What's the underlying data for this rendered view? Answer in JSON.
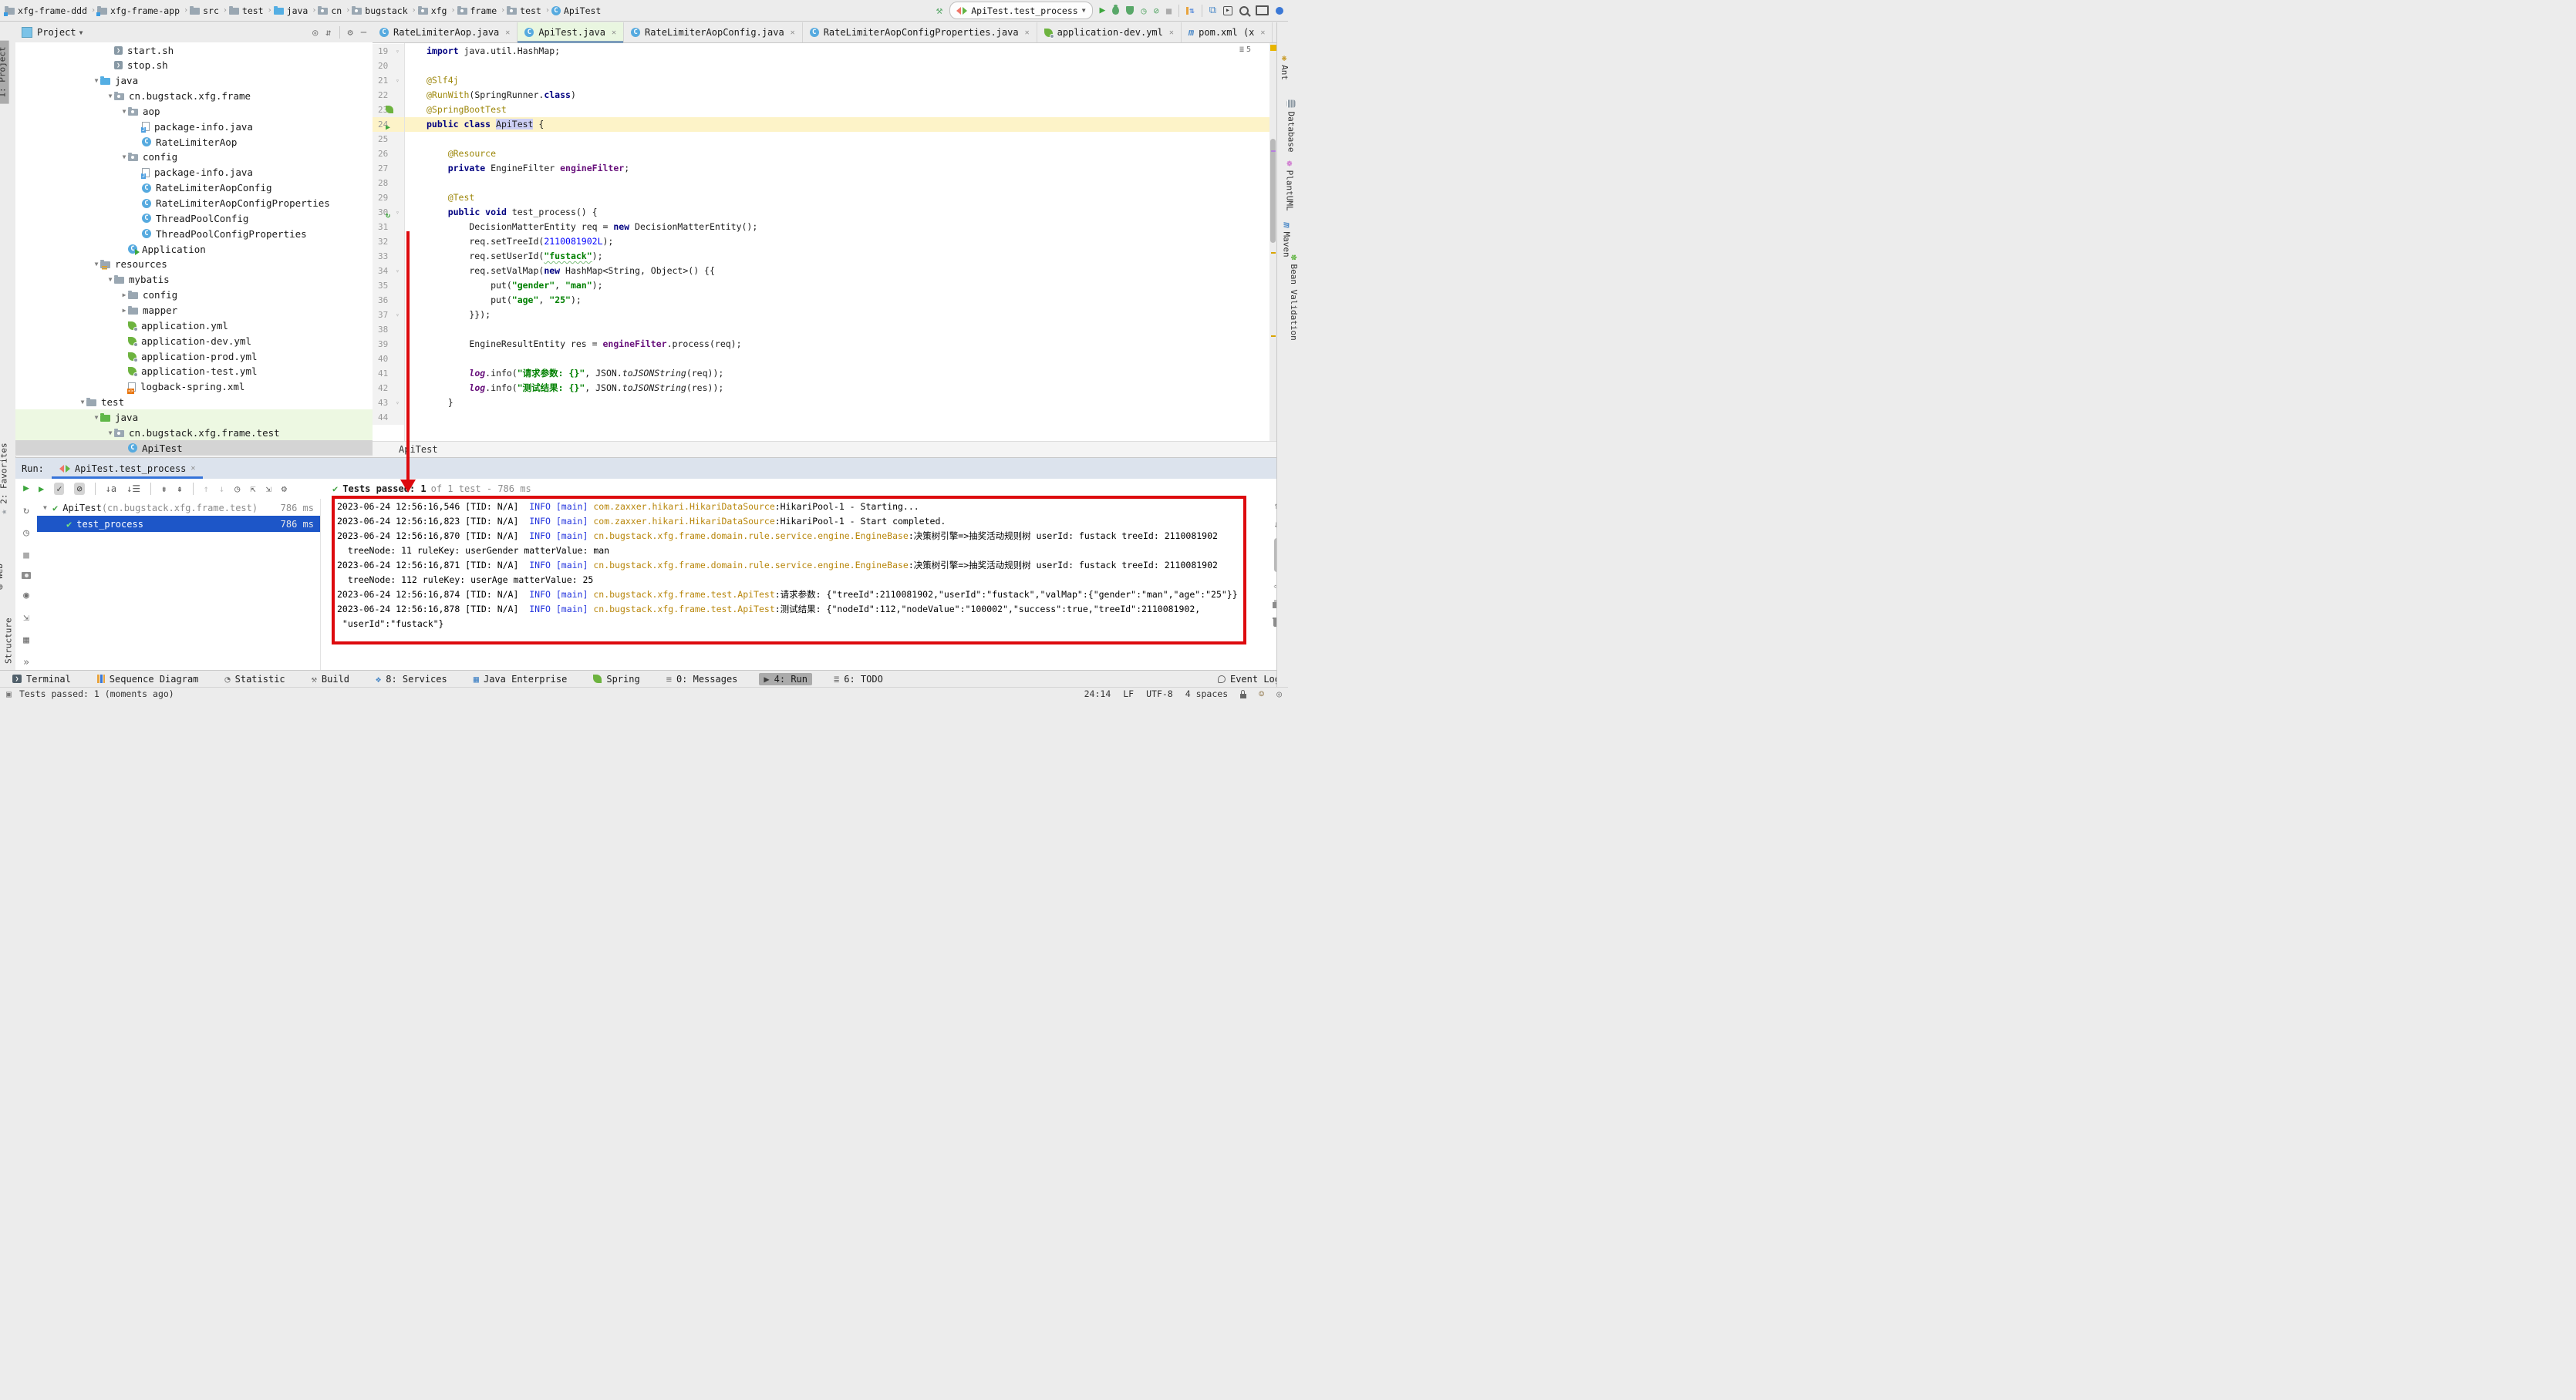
{
  "titlebar": {
    "breadcrumbs": [
      {
        "icon": "module-folder",
        "label": "xfg-frame-ddd"
      },
      {
        "icon": "module-folder",
        "label": "xfg-frame-app"
      },
      {
        "icon": "folder",
        "label": "src"
      },
      {
        "icon": "folder",
        "label": "test"
      },
      {
        "icon": "java-folder",
        "label": "java"
      },
      {
        "icon": "package",
        "label": "cn"
      },
      {
        "icon": "package",
        "label": "bugstack"
      },
      {
        "icon": "package",
        "label": "xfg"
      },
      {
        "icon": "package",
        "label": "frame"
      },
      {
        "icon": "package",
        "label": "test"
      },
      {
        "icon": "class",
        "label": "ApiTest"
      }
    ],
    "run_config_label": "ApiTest.test_process",
    "actions": [
      "build-hammer",
      "run",
      "debug",
      "coverage",
      "profiler",
      "profiler-attach",
      "stop",
      "sep",
      "update-sync",
      "sep",
      "project-structure",
      "run-anything",
      "search-everywhere",
      "monitor",
      "presence"
    ]
  },
  "tabs": [
    {
      "icon": "class",
      "label": "RateLimiterAop.java",
      "active": false
    },
    {
      "icon": "junit-class",
      "label": "ApiTest.java",
      "active": true
    },
    {
      "icon": "class",
      "label": "RateLimiterAopConfig.java",
      "active": false
    },
    {
      "icon": "class",
      "label": "RateLimiterAopConfigProperties.java",
      "active": false
    },
    {
      "icon": "spring-yml",
      "label": "application-dev.yml",
      "active": false
    },
    {
      "icon": "maven",
      "label": "pom.xml (x",
      "active": false
    }
  ],
  "tab_overflow": {
    "icon": "tab-list",
    "count": "5"
  },
  "project": {
    "title": "Project",
    "header_icons": [
      "locate",
      "collapse-all",
      "sep",
      "settings",
      "hide"
    ],
    "tree": [
      {
        "depth": 5,
        "arrow": "",
        "icon": "sh",
        "label": "start.sh",
        "bg": ""
      },
      {
        "depth": 5,
        "arrow": "",
        "icon": "sh",
        "label": "stop.sh",
        "bg": ""
      },
      {
        "depth": 4,
        "arrow": "down",
        "icon": "java-folder",
        "label": "java",
        "bg": ""
      },
      {
        "depth": 5,
        "arrow": "down",
        "icon": "package",
        "label": "cn.bugstack.xfg.frame",
        "bg": ""
      },
      {
        "depth": 6,
        "arrow": "down",
        "icon": "package",
        "label": "aop",
        "bg": ""
      },
      {
        "depth": 7,
        "arrow": "",
        "icon": "pkginfo",
        "label": "package-info.java",
        "bg": ""
      },
      {
        "depth": 7,
        "arrow": "",
        "icon": "class",
        "label": "RateLimiterAop",
        "bg": ""
      },
      {
        "depth": 6,
        "arrow": "down",
        "icon": "package",
        "label": "config",
        "bg": ""
      },
      {
        "depth": 7,
        "arrow": "",
        "icon": "pkginfo",
        "label": "package-info.java",
        "bg": ""
      },
      {
        "depth": 7,
        "arrow": "",
        "icon": "class",
        "label": "RateLimiterAopConfig",
        "bg": ""
      },
      {
        "depth": 7,
        "arrow": "",
        "icon": "class",
        "label": "RateLimiterAopConfigProperties",
        "bg": ""
      },
      {
        "depth": 7,
        "arrow": "",
        "icon": "class",
        "label": "ThreadPoolConfig",
        "bg": ""
      },
      {
        "depth": 7,
        "arrow": "",
        "icon": "class",
        "label": "ThreadPoolConfigProperties",
        "bg": ""
      },
      {
        "depth": 6,
        "arrow": "",
        "icon": "class-run",
        "label": "Application",
        "bg": ""
      },
      {
        "depth": 4,
        "arrow": "down",
        "icon": "resources-folder",
        "label": "resources",
        "bg": ""
      },
      {
        "depth": 5,
        "arrow": "down",
        "icon": "folder",
        "label": "mybatis",
        "bg": ""
      },
      {
        "depth": 6,
        "arrow": "right",
        "icon": "folder",
        "label": "config",
        "bg": ""
      },
      {
        "depth": 6,
        "arrow": "right",
        "icon": "folder",
        "label": "mapper",
        "bg": ""
      },
      {
        "depth": 6,
        "arrow": "",
        "icon": "spring-yml",
        "label": "application.yml",
        "bg": ""
      },
      {
        "depth": 6,
        "arrow": "",
        "icon": "spring-yml",
        "label": "application-dev.yml",
        "bg": ""
      },
      {
        "depth": 6,
        "arrow": "",
        "icon": "spring-yml",
        "label": "application-prod.yml",
        "bg": ""
      },
      {
        "depth": 6,
        "arrow": "",
        "icon": "spring-yml",
        "label": "application-test.yml",
        "bg": ""
      },
      {
        "depth": 6,
        "arrow": "",
        "icon": "xml",
        "label": "logback-spring.xml",
        "bg": ""
      },
      {
        "depth": 3,
        "arrow": "down",
        "icon": "folder",
        "label": "test",
        "bg": ""
      },
      {
        "depth": 4,
        "arrow": "down",
        "icon": "test-folder",
        "label": "java",
        "bg": "green"
      },
      {
        "depth": 5,
        "arrow": "down",
        "icon": "package",
        "label": "cn.bugstack.xfg.frame.test",
        "bg": "green"
      },
      {
        "depth": 6,
        "arrow": "",
        "icon": "class",
        "label": "ApiTest",
        "bg": "sel"
      }
    ]
  },
  "editor": {
    "breadcrumb": "ApiTest",
    "inspections_count": "5",
    "lines": [
      {
        "no": "19",
        "gutter": "",
        "fold": "v",
        "caret": false,
        "segs": [
          [
            "k",
            "import"
          ],
          [
            "p",
            " java.util.HashMap;"
          ]
        ]
      },
      {
        "no": "20",
        "gutter": "",
        "fold": "",
        "caret": false,
        "segs": []
      },
      {
        "no": "21",
        "gutter": "",
        "fold": "v",
        "caret": false,
        "segs": [
          [
            "ann",
            "@Slf4j"
          ]
        ]
      },
      {
        "no": "22",
        "gutter": "",
        "fold": "",
        "caret": false,
        "segs": [
          [
            "ann",
            "@RunWith"
          ],
          [
            "p",
            "(SpringRunner."
          ],
          [
            "k",
            "class"
          ],
          [
            "p",
            ")"
          ]
        ]
      },
      {
        "no": "23",
        "gutter": "leaf",
        "fold": "",
        "caret": false,
        "segs": [
          [
            "ann",
            "@SpringBootTest"
          ]
        ]
      },
      {
        "no": "24",
        "gutter": "run",
        "fold": "",
        "caret": true,
        "segs": [
          [
            "k",
            "public class "
          ],
          [
            "hlw",
            "ApiTest"
          ],
          [
            "p",
            " {"
          ]
        ]
      },
      {
        "no": "25",
        "gutter": "",
        "fold": "",
        "caret": false,
        "segs": []
      },
      {
        "no": "26",
        "gutter": "",
        "fold": "",
        "caret": false,
        "segs": [
          [
            "p",
            "    "
          ],
          [
            "ann",
            "@Resource"
          ]
        ]
      },
      {
        "no": "27",
        "gutter": "",
        "fold": "",
        "caret": false,
        "segs": [
          [
            "p",
            "    "
          ],
          [
            "k",
            "private"
          ],
          [
            "p",
            " EngineFilter "
          ],
          [
            "f",
            "engineFilter"
          ],
          [
            "p",
            ";"
          ]
        ]
      },
      {
        "no": "28",
        "gutter": "",
        "fold": "",
        "caret": false,
        "segs": []
      },
      {
        "no": "29",
        "gutter": "",
        "fold": "",
        "caret": false,
        "segs": [
          [
            "p",
            "    "
          ],
          [
            "ann",
            "@Test"
          ]
        ]
      },
      {
        "no": "30",
        "gutter": "rerun",
        "fold": "v",
        "caret": false,
        "segs": [
          [
            "p",
            "    "
          ],
          [
            "k",
            "public void"
          ],
          [
            "p",
            " test_process() {"
          ]
        ]
      },
      {
        "no": "31",
        "gutter": "",
        "fold": "",
        "caret": false,
        "segs": [
          [
            "p",
            "        DecisionMatterEntity req = "
          ],
          [
            "k",
            "new"
          ],
          [
            "p",
            " DecisionMatterEntity();"
          ]
        ]
      },
      {
        "no": "32",
        "gutter": "",
        "fold": "",
        "caret": false,
        "segs": [
          [
            "p",
            "        req.setTreeId("
          ],
          [
            "n",
            "2110081902L"
          ],
          [
            "p",
            ");"
          ]
        ]
      },
      {
        "no": "33",
        "gutter": "",
        "fold": "",
        "caret": false,
        "segs": [
          [
            "p",
            "        req.setUserId("
          ],
          [
            "styp",
            "\"fustack\""
          ],
          [
            "p",
            ");"
          ]
        ]
      },
      {
        "no": "34",
        "gutter": "",
        "fold": "v",
        "caret": false,
        "segs": [
          [
            "p",
            "        req.setValMap("
          ],
          [
            "k",
            "new"
          ],
          [
            "p",
            " HashMap<String, Object>() {{"
          ]
        ]
      },
      {
        "no": "35",
        "gutter": "",
        "fold": "",
        "caret": false,
        "segs": [
          [
            "p",
            "            put("
          ],
          [
            "s",
            "\"gender\""
          ],
          [
            "p",
            ", "
          ],
          [
            "s",
            "\"man\""
          ],
          [
            "p",
            ");"
          ]
        ]
      },
      {
        "no": "36",
        "gutter": "",
        "fold": "",
        "caret": false,
        "segs": [
          [
            "p",
            "            put("
          ],
          [
            "s",
            "\"age\""
          ],
          [
            "p",
            ", "
          ],
          [
            "s",
            "\"25\""
          ],
          [
            "p",
            ");"
          ]
        ]
      },
      {
        "no": "37",
        "gutter": "",
        "fold": "v",
        "caret": false,
        "segs": [
          [
            "p",
            "        }});"
          ]
        ]
      },
      {
        "no": "38",
        "gutter": "",
        "fold": "",
        "caret": false,
        "segs": []
      },
      {
        "no": "39",
        "gutter": "",
        "fold": "",
        "caret": false,
        "segs": [
          [
            "p",
            "        EngineResultEntity res = "
          ],
          [
            "f",
            "engineFilter"
          ],
          [
            "p",
            ".process(req);"
          ]
        ]
      },
      {
        "no": "40",
        "gutter": "",
        "fold": "",
        "caret": false,
        "segs": []
      },
      {
        "no": "41",
        "gutter": "",
        "fold": "",
        "caret": false,
        "segs": [
          [
            "p",
            "        "
          ],
          [
            "sf",
            "log"
          ],
          [
            "p",
            ".info("
          ],
          [
            "s",
            "\"请求参数: {}\""
          ],
          [
            "p",
            ", JSON."
          ],
          [
            "itl",
            "toJSONString"
          ],
          [
            "p",
            "(req));"
          ]
        ]
      },
      {
        "no": "42",
        "gutter": "",
        "fold": "",
        "caret": false,
        "segs": [
          [
            "p",
            "        "
          ],
          [
            "sf",
            "log"
          ],
          [
            "p",
            ".info("
          ],
          [
            "s",
            "\"测试结果: {}\""
          ],
          [
            "p",
            ", JSON."
          ],
          [
            "itl",
            "toJSONString"
          ],
          [
            "p",
            "(res));"
          ]
        ]
      },
      {
        "no": "43",
        "gutter": "",
        "fold": "v",
        "caret": false,
        "segs": [
          [
            "p",
            "    }"
          ]
        ]
      },
      {
        "no": "44",
        "gutter": "",
        "fold": "",
        "caret": false,
        "segs": []
      }
    ]
  },
  "run_panel": {
    "label": "Run:",
    "tab_label": "ApiTest.test_process",
    "status_passed": "Tests passed: 1",
    "status_rest": "of 1 test - 786 ms",
    "toolbar": [
      "rerun",
      "check",
      "skip",
      "sep",
      "sort-alpha",
      "sort-list",
      "sep",
      "expand-all",
      "collapse-all",
      "sep",
      "prev",
      "next",
      "history",
      "import",
      "export",
      "settings"
    ],
    "left_strip": [
      "rerun",
      "rerun-failed",
      "autotest",
      "stop",
      "thread-dump",
      "profiler-snap",
      "import-tests",
      "layout-grid",
      "more"
    ],
    "tree": [
      {
        "arrow": "down",
        "check": true,
        "label": "ApiTest (cn.bugstack.xfg.frame.test)",
        "pkg_dim": true,
        "time": "786 ms",
        "selected": false
      },
      {
        "arrow": "",
        "check": true,
        "label": "test_process",
        "time": "786 ms",
        "selected": true
      }
    ],
    "console": [
      {
        "segs": [
          [
            "ct",
            "2023-06-24 12:56:16,546 [TID: N/A]  "
          ],
          [
            "ci",
            "INFO [main] "
          ],
          [
            "cl",
            "com.zaxxer.hikari.HikariDataSource"
          ],
          [
            "ct",
            ":HikariPool-1 - Starting..."
          ]
        ]
      },
      {
        "segs": [
          [
            "ct",
            "2023-06-24 12:56:16,823 [TID: N/A]  "
          ],
          [
            "ci",
            "INFO [main] "
          ],
          [
            "cl",
            "com.zaxxer.hikari.HikariDataSource"
          ],
          [
            "ct",
            ":HikariPool-1 - Start completed."
          ]
        ]
      },
      {
        "segs": [
          [
            "ct",
            "2023-06-24 12:56:16,870 [TID: N/A]  "
          ],
          [
            "ci",
            "INFO [main] "
          ],
          [
            "cl",
            "cn.bugstack.xfg.frame.domain.rule.service.engine.EngineBase"
          ],
          [
            "ct",
            ":决策树引擎=>抽奖活动规则树 userId: fustack treeId: 2110081902"
          ]
        ]
      },
      {
        "segs": [
          [
            "ct",
            "  treeNode: 11 ruleKey: userGender matterValue: man"
          ]
        ]
      },
      {
        "segs": [
          [
            "ct",
            "2023-06-24 12:56:16,871 [TID: N/A]  "
          ],
          [
            "ci",
            "INFO [main] "
          ],
          [
            "cl",
            "cn.bugstack.xfg.frame.domain.rule.service.engine.EngineBase"
          ],
          [
            "ct",
            ":决策树引擎=>抽奖活动规则树 userId: fustack treeId: 2110081902"
          ]
        ]
      },
      {
        "segs": [
          [
            "ct",
            "  treeNode: 112 ruleKey: userAge matterValue: 25"
          ]
        ]
      },
      {
        "segs": [
          [
            "ct",
            "2023-06-24 12:56:16,874 [TID: N/A]  "
          ],
          [
            "ci",
            "INFO [main] "
          ],
          [
            "cl",
            "cn.bugstack.xfg.frame.test.ApiTest"
          ],
          [
            "ct",
            ":请求参数: {\"treeId\":2110081902,\"userId\":\"fustack\",\"valMap\":{\"gender\":\"man\",\"age\":\"25\"}}"
          ]
        ]
      },
      {
        "segs": [
          [
            "ct",
            "2023-06-24 12:56:16,878 [TID: N/A]  "
          ],
          [
            "ci",
            "INFO [main] "
          ],
          [
            "cl",
            "cn.bugstack.xfg.frame.test.ApiTest"
          ],
          [
            "ct",
            ":测试结果: {\"nodeId\":112,\"nodeValue\":\"100002\",\"success\":true,\"treeId\":2110081902,"
          ]
        ]
      },
      {
        "segs": [
          [
            "ct",
            " \"userId\":\"fustack\"}"
          ]
        ]
      }
    ]
  },
  "left_strip": {
    "project_label": "1: Project",
    "bottom_items": [
      {
        "icon": "star",
        "label": "2: Favorites"
      },
      {
        "icon": "web",
        "label": "Web"
      },
      {
        "icon": "structure",
        "label": "7: Structure"
      }
    ]
  },
  "right_strip": {
    "items": [
      {
        "icon": "ant",
        "label": "Ant"
      },
      {
        "icon": "database",
        "label": "Database"
      },
      {
        "icon": "plantuml",
        "label": "PlantUML"
      },
      {
        "icon": "maven",
        "label": "Maven"
      },
      {
        "icon": "beanval",
        "label": "Bean Validation"
      }
    ]
  },
  "bottombar": {
    "items": [
      {
        "icon": "terminal",
        "label": "Terminal",
        "active": false
      },
      {
        "icon": "sequence",
        "label": "Sequence Diagram",
        "active": false
      },
      {
        "icon": "statistic",
        "label": "Statistic",
        "active": false
      },
      {
        "icon": "build",
        "label": "Build",
        "active": false
      },
      {
        "icon": "services",
        "label": "8: Services",
        "active": false
      },
      {
        "icon": "javaee",
        "label": "Java Enterprise",
        "active": false
      },
      {
        "icon": "spring",
        "label": "Spring",
        "active": false
      },
      {
        "icon": "messages",
        "label": "0: Messages",
        "active": false
      },
      {
        "icon": "run-small",
        "label": "4: Run",
        "active": true
      },
      {
        "icon": "todo",
        "label": "6: TODO",
        "active": false
      }
    ],
    "event_log": "Event Log"
  },
  "statusbar": {
    "left": "Tests passed: 1 (moments ago)",
    "position": "24:14",
    "line_sep": "LF",
    "encoding": "UTF-8",
    "indent": "4 spaces",
    "icons": [
      "lock",
      "hector",
      "permissions"
    ]
  },
  "colors": {
    "annotation_red": "#DD0A0E",
    "selection_blue": "#1D56C8",
    "tab_active_green": "#E9F6E0",
    "caret_line": "#FDF3C8",
    "console_info_blue": "#2233DD",
    "console_logger_gold": "#B8860B"
  }
}
